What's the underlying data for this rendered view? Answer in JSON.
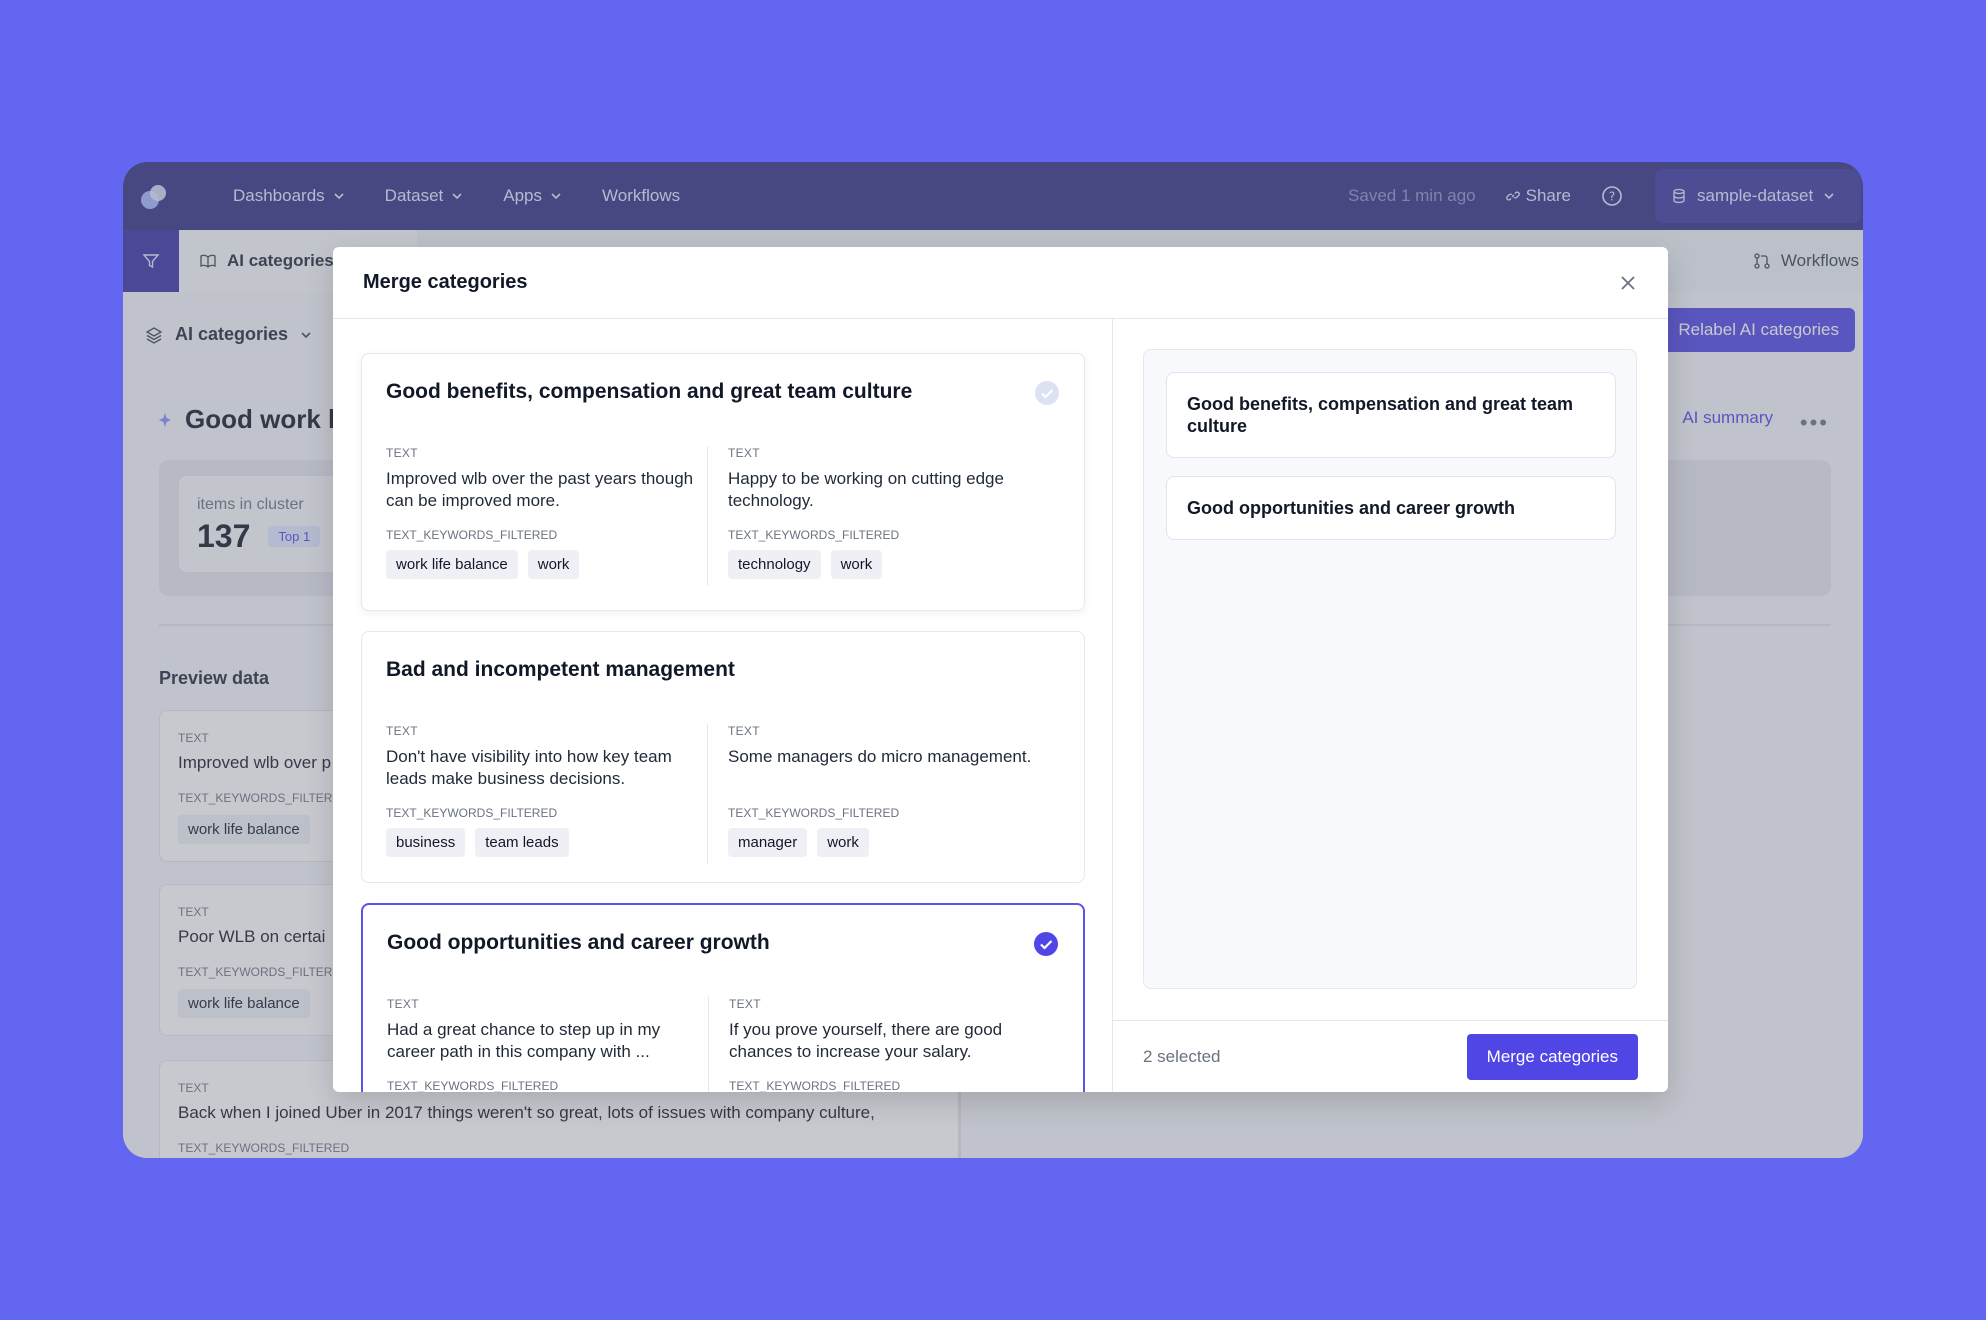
{
  "topbar": {
    "nav": [
      {
        "label": "Dashboards",
        "has_dropdown": true
      },
      {
        "label": "Dataset",
        "has_dropdown": true
      },
      {
        "label": "Apps",
        "has_dropdown": true
      },
      {
        "label": "Workflows",
        "has_dropdown": false
      }
    ],
    "saved_status": "Saved 1 min ago",
    "share_label": "Share",
    "dataset_label": "sample-dataset"
  },
  "subbar": {
    "active_tab": "AI categories",
    "workflows_tab": "Workflows"
  },
  "background": {
    "category_select": "AI categories",
    "relabel_button": "Relabel AI categories",
    "cluster_title": "Good work l",
    "ai_summary": "AI summary",
    "stat_label": "items in cluster",
    "stat_value": "137",
    "stat_badge": "Top 1",
    "preview_title": "Preview data",
    "items": [
      {
        "label": "TEXT",
        "text": "Improved wlb over p",
        "kw_label": "TEXT_KEYWORDS_FILTERED",
        "tag": "work life balance"
      },
      {
        "label": "TEXT",
        "text": "Poor WLB on certai",
        "kw_label": "TEXT_KEYWORDS_FILTERED",
        "tag": "work life balance"
      },
      {
        "label": "TEXT",
        "text": "Back when I joined Uber in 2017 things weren't so great, lots of issues with company culture,",
        "kw_label": "TEXT_KEYWORDS_FILTERED"
      }
    ]
  },
  "modal": {
    "title": "Merge categories",
    "categories": [
      {
        "title": "Good benefits, compensation and great team culture",
        "checked": "light",
        "left": {
          "label": "TEXT",
          "text": "Improved wlb over the past years though can be improved more.",
          "kw_label": "TEXT_KEYWORDS_FILTERED",
          "tags": [
            "work life balance",
            "work"
          ]
        },
        "right": {
          "label": "TEXT",
          "text": "Happy to be working on cutting edge technology.",
          "kw_label": "TEXT_KEYWORDS_FILTERED",
          "tags": [
            "technology",
            "work"
          ]
        }
      },
      {
        "title": "Bad and incompetent management",
        "checked": "none",
        "left": {
          "label": "TEXT",
          "text": "Don't have visibility into how key team leads make business decisions.",
          "kw_label": "TEXT_KEYWORDS_FILTERED",
          "tags": [
            "business",
            "team leads"
          ]
        },
        "right": {
          "label": "TEXT",
          "text": "Some managers do micro management.",
          "kw_label": "TEXT_KEYWORDS_FILTERED",
          "tags": [
            "manager",
            "work"
          ]
        }
      },
      {
        "title": "Good opportunities and career growth",
        "checked": "solid",
        "left": {
          "label": "TEXT",
          "text": "Had a great chance to step up in my career path in this company with ...",
          "kw_label": "TEXT_KEYWORDS_FILTERED",
          "tags": []
        },
        "right": {
          "label": "TEXT",
          "text": "If you prove yourself, there are good chances to increase your salary.",
          "kw_label": "TEXT_KEYWORDS_FILTERED",
          "tags": []
        }
      }
    ],
    "selected_items": [
      "Good benefits, compensation and great team culture",
      "Good opportunities and career growth"
    ],
    "selected_count": "2 selected",
    "merge_button": "Merge categories"
  },
  "colors": {
    "page_bg": "#6366F1",
    "topbar": "#312E81",
    "accent": "#4F46E5"
  }
}
